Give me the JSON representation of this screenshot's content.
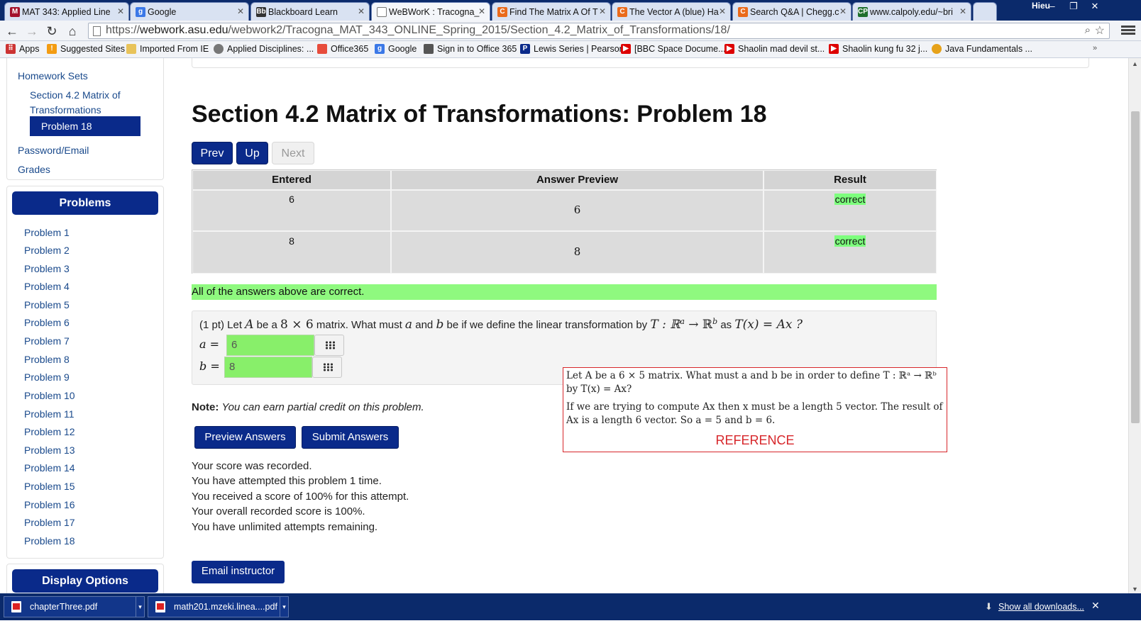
{
  "browser": {
    "tabs": [
      {
        "title": "MAT 343: Applied Line",
        "favicon": "asu-icon"
      },
      {
        "title": "Google",
        "favicon": "google-icon"
      },
      {
        "title": "Blackboard Learn",
        "favicon": "blackboard-icon"
      },
      {
        "title": "WeBWorK : Tracogna_",
        "favicon": "page-icon"
      },
      {
        "title": "Find The Matrix A Of T",
        "favicon": "chegg-icon"
      },
      {
        "title": "The Vector A (blue) Ha",
        "favicon": "chegg-icon"
      },
      {
        "title": "Search Q&A | Chegg.c",
        "favicon": "chegg-icon"
      },
      {
        "title": "www.calpoly.edu/~bri",
        "favicon": "calpoly-icon"
      }
    ],
    "user": "Hieu",
    "url": {
      "scheme": "https://",
      "host": "webwork.asu.edu",
      "path": "/webwork2/Tracogna_MAT_343_ONLINE_Spring_2015/Section_4.2_Matrix_of_Transformations/18/"
    },
    "bookmarks": [
      "Apps",
      "Suggested Sites",
      "Imported From IE",
      "Applied Disciplines: ...",
      "Office365",
      "Google",
      "Sign in to Office 365",
      "Lewis Series | Pearson",
      "[BBC Space Docume...",
      "Shaolin mad devil st...",
      "Shaolin kung fu 32 j...",
      "Java Fundamentals ..."
    ]
  },
  "sidebar": {
    "homework_sets": "Homework Sets",
    "set_name_line1": "Section 4.2 Matrix of",
    "set_name_line2": "Transformations",
    "current_problem": "Problem 18",
    "password_email": "Password/Email",
    "grades": "Grades",
    "problems_heading": "Problems",
    "problems": [
      "Problem 1",
      "Problem 2",
      "Problem 3",
      "Problem 4",
      "Problem 5",
      "Problem 6",
      "Problem 7",
      "Problem 8",
      "Problem 9",
      "Problem 10",
      "Problem 11",
      "Problem 12",
      "Problem 13",
      "Problem 14",
      "Problem 15",
      "Problem 16",
      "Problem 17",
      "Problem 18"
    ],
    "display_options_heading": "Display Options"
  },
  "main": {
    "title": "Section 4.2 Matrix of Transformations: Problem 18",
    "nav": {
      "prev": "Prev",
      "up": "Up",
      "next": "Next"
    },
    "results_table": {
      "headers": [
        "Entered",
        "Answer Preview",
        "Result"
      ],
      "rows": [
        {
          "entered": "6",
          "preview": "6",
          "result": "correct"
        },
        {
          "entered": "8",
          "preview": "8",
          "result": "correct"
        }
      ]
    },
    "all_correct_message": "All of the answers above are correct.",
    "problem": {
      "points": "(1 pt) Let",
      "matrix_var": "A",
      "text_be_a": "be a",
      "dims": "8 × 6",
      "text_matrix": "matrix. What must",
      "var_a": "a",
      "text_and": "and",
      "var_b": "b",
      "text_define": "be if we define the linear transformation by",
      "mapping": "T : ℝ",
      "sup_a": "a",
      "arrow": " → ℝ",
      "sup_b": "b",
      "text_as": "as",
      "formula": "T(x) = Ax ?",
      "answers": [
        {
          "label": "a =",
          "value": "6"
        },
        {
          "label": "b =",
          "value": "8"
        }
      ]
    },
    "reference": {
      "paragraph1": "Let A be a 6 × 5 matrix. What must a and b be in order to define T : ℝᵃ → ℝᵇ by T(x) = Ax?",
      "paragraph2": "If we are trying to compute Ax then x must be a length 5 vector. The result of Ax is a length 6 vector. So a = 5 and b = 6.",
      "label": "REFERENCE"
    },
    "note_label": "Note:",
    "note_text": "You can earn partial credit on this problem.",
    "preview_button": "Preview Answers",
    "submit_button": "Submit Answers",
    "score_lines": [
      "Your score was recorded.",
      "You have attempted this problem 1 time.",
      "You received a score of 100% for this attempt.",
      "Your overall recorded score is 100%.",
      "You have unlimited attempts remaining."
    ],
    "email_button": "Email instructor"
  },
  "downloads": {
    "items": [
      "chapterThree.pdf",
      "math201.mzeki.linea....pdf"
    ],
    "show_all": "Show all downloads..."
  },
  "colors": {
    "webwork_navy": "#0a2a8a",
    "correct_green": "#7dff7d",
    "reference_red": "#d7262a",
    "chrome_frame": "#0b2a6b"
  }
}
